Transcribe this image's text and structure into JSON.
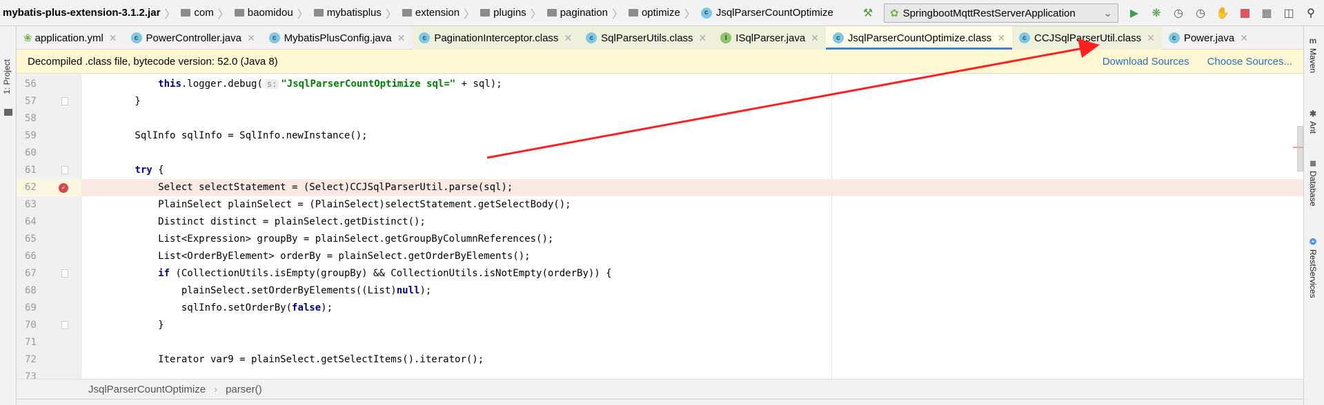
{
  "navbar": {
    "crumbs": [
      "mybatis-plus-extension-3.1.2.jar",
      "com",
      "baomidou",
      "mybatisplus",
      "extension",
      "plugins",
      "pagination",
      "optimize",
      "JsqlParserCountOptimize"
    ]
  },
  "toolbar": {
    "run_config": "SpringbootMqttRestServerApplication",
    "icons": [
      "build-hammer-icon",
      "run-icon",
      "debug-icon",
      "coverage-icon",
      "profile-icon",
      "attach-icon",
      "stop-icon",
      "project-structure-icon",
      "layout-icon",
      "search-icon"
    ]
  },
  "left_strip": {
    "project_label": "1: Project"
  },
  "right_strip": {
    "tools": [
      "Maven",
      "Ant",
      "Database",
      "RestServices"
    ]
  },
  "tabs": [
    {
      "label": "application.yml",
      "icon": "yml",
      "state": "normal"
    },
    {
      "label": "PowerController.java",
      "icon": "c",
      "state": "normal"
    },
    {
      "label": "MybatisPlusConfig.java",
      "icon": "c",
      "state": "normal"
    },
    {
      "label": "PaginationInterceptor.class",
      "icon": "c",
      "state": "class"
    },
    {
      "label": "SqlParserUtils.class",
      "icon": "c",
      "state": "class"
    },
    {
      "label": "ISqlParser.java",
      "icon": "i",
      "state": "class"
    },
    {
      "label": "JsqlParserCountOptimize.class",
      "icon": "c",
      "state": "active"
    },
    {
      "label": "CCJSqlParserUtil.class",
      "icon": "c",
      "state": "class"
    },
    {
      "label": "Power.java",
      "icon": "c",
      "state": "normal"
    }
  ],
  "banner": {
    "text": "Decompiled .class file, bytecode version: 52.0 (Java 8)",
    "download": "Download Sources",
    "choose": "Choose Sources..."
  },
  "code": [
    {
      "n": "56",
      "fold": false,
      "seg": [
        [
          "            ",
          ""
        ],
        [
          "this",
          "kw"
        ],
        [
          ".logger.debug(",
          ""
        ],
        [
          "s:",
          "hint"
        ],
        [
          "\"JsqlParserCountOptimize sql=\"",
          "str"
        ],
        [
          " + sql);",
          ""
        ]
      ]
    },
    {
      "n": "57",
      "fold": true,
      "seg": [
        [
          "        }",
          ""
        ]
      ]
    },
    {
      "n": "58",
      "fold": false,
      "seg": []
    },
    {
      "n": "59",
      "fold": false,
      "seg": [
        [
          "        SqlInfo sqlInfo = SqlInfo.newInstance();",
          ""
        ]
      ]
    },
    {
      "n": "60",
      "fold": false,
      "seg": []
    },
    {
      "n": "61",
      "fold": true,
      "seg": [
        [
          "        ",
          ""
        ],
        [
          "try",
          "kw"
        ],
        [
          " {",
          ""
        ]
      ]
    },
    {
      "n": "62",
      "fold": false,
      "bp": true,
      "seg": [
        [
          "            Select selectStatement = (Select)CCJSqlParserUtil.parse(sql);",
          ""
        ]
      ]
    },
    {
      "n": "63",
      "fold": false,
      "seg": [
        [
          "            PlainSelect plainSelect = (PlainSelect)selectStatement.getSelectBody();",
          ""
        ]
      ]
    },
    {
      "n": "64",
      "fold": false,
      "seg": [
        [
          "            Distinct distinct = plainSelect.getDistinct();",
          ""
        ]
      ]
    },
    {
      "n": "65",
      "fold": false,
      "seg": [
        [
          "            List<Expression> groupBy = plainSelect.getGroupByColumnReferences();",
          ""
        ]
      ]
    },
    {
      "n": "66",
      "fold": false,
      "seg": [
        [
          "            List<OrderByElement> orderBy = plainSelect.getOrderByElements();",
          ""
        ]
      ]
    },
    {
      "n": "67",
      "fold": true,
      "seg": [
        [
          "            ",
          ""
        ],
        [
          "if",
          "kw"
        ],
        [
          " (CollectionUtils.isEmpty(groupBy) && CollectionUtils.isNotEmpty(orderBy)) {",
          ""
        ]
      ]
    },
    {
      "n": "68",
      "fold": false,
      "seg": [
        [
          "                plainSelect.setOrderByElements((List)",
          ""
        ],
        [
          "null",
          "kw"
        ],
        [
          ");",
          ""
        ]
      ]
    },
    {
      "n": "69",
      "fold": false,
      "seg": [
        [
          "                sqlInfo.setOrderBy(",
          ""
        ],
        [
          "false",
          "kw"
        ],
        [
          ");",
          ""
        ]
      ]
    },
    {
      "n": "70",
      "fold": true,
      "seg": [
        [
          "            }",
          ""
        ]
      ]
    },
    {
      "n": "71",
      "fold": false,
      "seg": []
    },
    {
      "n": "72",
      "fold": false,
      "seg": [
        [
          "            Iterator var9 = plainSelect.getSelectItems().iterator();",
          ""
        ]
      ]
    },
    {
      "n": "73",
      "fold": false,
      "seg": []
    }
  ],
  "bottom": {
    "class": "JsqlParserCountOptimize",
    "method": "parser()"
  },
  "colors": {
    "keyword": "#000080",
    "string": "#008000",
    "active_tab_underline": "#4083c9",
    "annotation_arrow": "#ff2020",
    "breakpoint": "#d94848"
  }
}
